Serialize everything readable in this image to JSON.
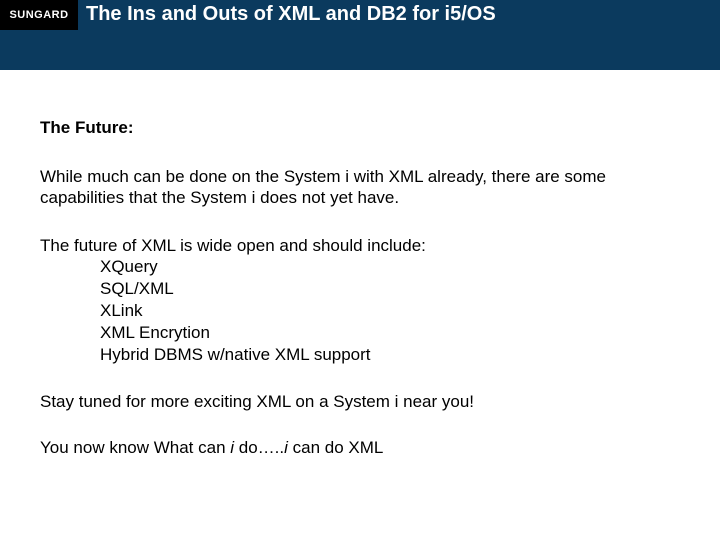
{
  "header": {
    "logo": "SUNGARD",
    "title": "The Ins and Outs of XML and DB2 for i5/OS"
  },
  "body": {
    "heading": "The Future:",
    "para1": "While much can be done on the System i with XML already, there are some capabilities that the System i does not yet have.",
    "list_intro": "The future of XML is wide open and should include:",
    "items": [
      "XQuery",
      "SQL/XML",
      "XLink",
      "XML Encrytion",
      "Hybrid DBMS w/native XML support"
    ],
    "closing1": "Stay tuned for more exciting XML on a System i near you!",
    "closing2_pre": "You now know What can ",
    "closing2_i1": "i",
    "closing2_mid": " do…..",
    "closing2_i2": "i",
    "closing2_post": " can do XML"
  }
}
